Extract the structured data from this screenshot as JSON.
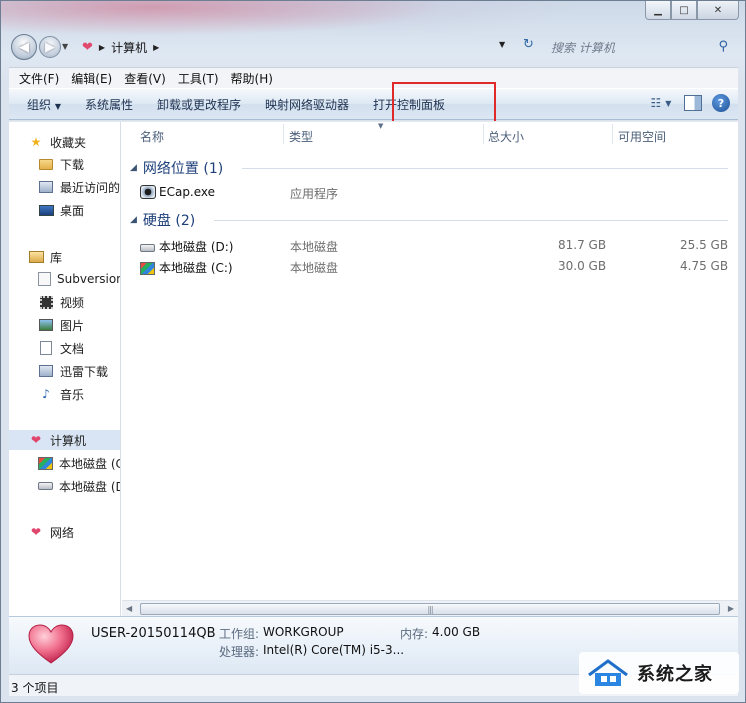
{
  "address": {
    "current": "计算机",
    "search_placeholder": "搜索 计算机"
  },
  "menubar": {
    "items": [
      "文件(F)",
      "编辑(E)",
      "查看(V)",
      "工具(T)",
      "帮助(H)"
    ]
  },
  "commandbar": {
    "organize": "组织",
    "items": [
      "系统属性",
      "卸载或更改程序",
      "映射网络驱动器",
      "打开控制面板"
    ],
    "highlight_color": "#e02a2a"
  },
  "navpane": {
    "favorites": "收藏夹",
    "favorites_items": [
      "下载",
      "最近访问的",
      "桌面"
    ],
    "libraries": "库",
    "library_items": [
      "Subversion",
      "视频",
      "图片",
      "文档",
      "迅雷下载",
      "音乐"
    ],
    "computer": "计算机",
    "computer_items": [
      "本地磁盘 (C",
      "本地磁盘 (D"
    ],
    "network": "网络"
  },
  "columns": {
    "name": "名称",
    "type": "类型",
    "total": "总大小",
    "free": "可用空间"
  },
  "groups": [
    {
      "title": "网络位置 (1)",
      "rows": [
        {
          "name": "ECap.exe",
          "type": "应用程序",
          "total": "",
          "free": ""
        }
      ]
    },
    {
      "title": "硬盘 (2)",
      "rows": [
        {
          "name": "本地磁盘 (D:)",
          "type": "本地磁盘",
          "total": "81.7 GB",
          "free": "25.5 GB"
        },
        {
          "name": "本地磁盘 (C:)",
          "type": "本地磁盘",
          "total": "30.0 GB",
          "free": "4.75 GB"
        }
      ]
    }
  ],
  "details": {
    "computer_name": "USER-20150114QB",
    "workgroup_label": "工作组:",
    "workgroup_value": "WORKGROUP",
    "memory_label": "内存:",
    "memory_value": "4.00 GB",
    "cpu_label": "处理器:",
    "cpu_value": "Intel(R) Core(TM) i5-3..."
  },
  "status": {
    "item_count": "3 个项目"
  },
  "watermark": {
    "text": "系统之家"
  }
}
